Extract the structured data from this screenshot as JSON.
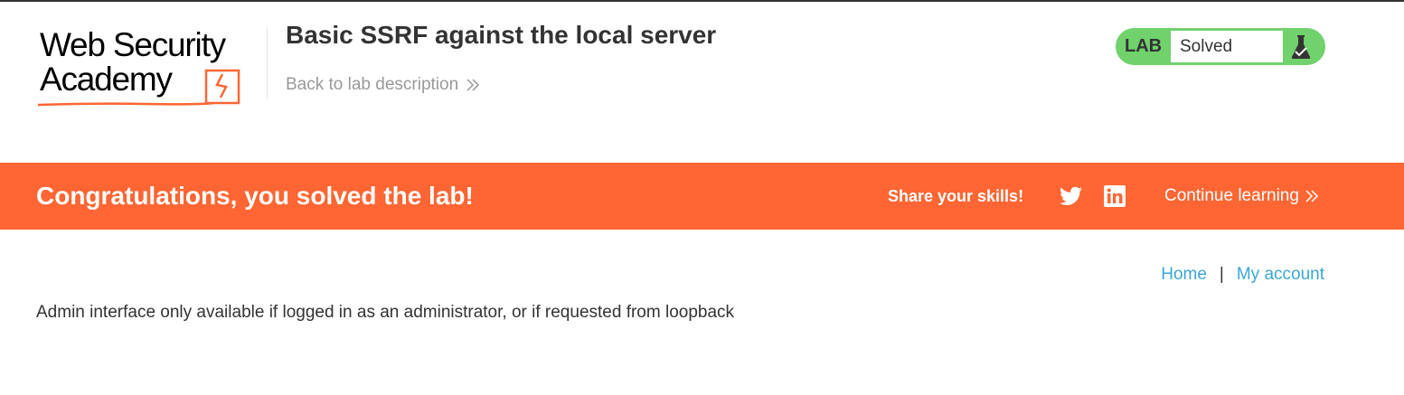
{
  "header": {
    "logo_line1": "Web Security",
    "logo_line2": "Academy",
    "lab_title": "Basic SSRF against the local server",
    "back_link_label": "Back to lab description"
  },
  "status": {
    "tag": "LAB",
    "state": "Solved",
    "icon": "flask-icon",
    "color": "#70d16d"
  },
  "banner": {
    "message": "Congratulations, you solved the lab!",
    "share_label": "Share your skills!",
    "share_icons": [
      "twitter-icon",
      "linkedin-icon"
    ],
    "continue_label": "Continue learning",
    "color": "#ff6633"
  },
  "nav": {
    "home_label": "Home",
    "separator": "|",
    "account_label": "My account",
    "link_color": "#3ba5d8"
  },
  "main": {
    "message": "Admin interface only available if logged in as an administrator, or if requested from loopback"
  }
}
